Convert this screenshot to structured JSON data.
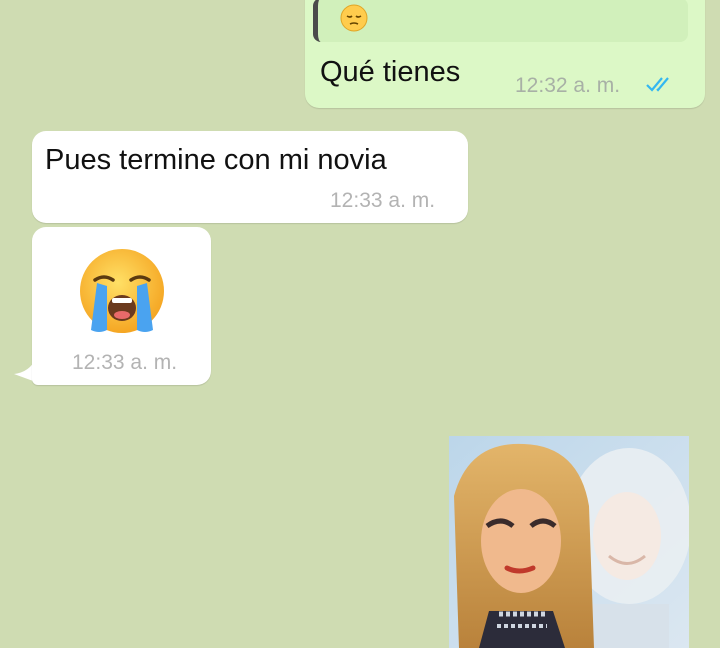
{
  "chat": {
    "messages": [
      {
        "direction": "outgoing",
        "quoted_emoji": "pensive-face-icon",
        "text": "Qué tienes",
        "time": "12:32 a. m.",
        "status": "read"
      },
      {
        "direction": "incoming",
        "text": "Pues termine con mi novia",
        "time": "12:33 a. m."
      },
      {
        "direction": "incoming",
        "emoji": "loudly-crying-face-icon",
        "time": "12:33 a. m."
      },
      {
        "direction": "incoming",
        "media": "sticker-photo"
      }
    ]
  },
  "colors": {
    "wallpaper": "#cfdcb2",
    "outgoing_bubble": "#dcf8c6",
    "incoming_bubble": "#ffffff",
    "read_ticks": "#34b7f1"
  }
}
